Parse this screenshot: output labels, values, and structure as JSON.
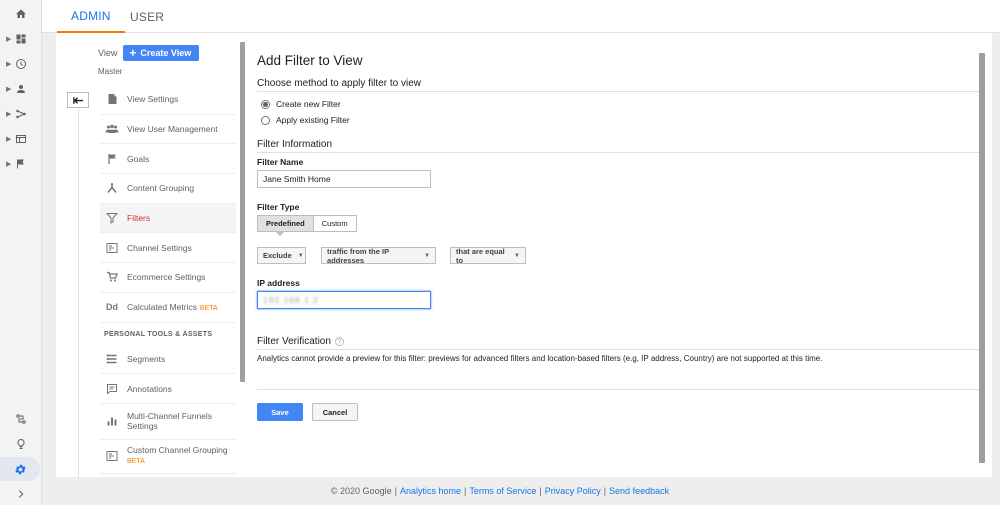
{
  "rail": {
    "icons": [
      "home-icon",
      "dashboard-icon",
      "clock-icon",
      "person-icon",
      "acquisition-icon",
      "behavior-icon",
      "flag-icon"
    ],
    "bottom_icons": [
      "discover-icon",
      "lightbulb-icon",
      "gear-icon",
      "expand-icon"
    ]
  },
  "tabs": [
    {
      "label": "ADMIN"
    },
    {
      "label": "USER"
    }
  ],
  "view": {
    "label": "View",
    "create_button": "Create View",
    "name": "Master"
  },
  "menu": {
    "items": [
      {
        "label": "View Settings",
        "icon": "document-icon"
      },
      {
        "label": "View User Management",
        "icon": "people-icon"
      },
      {
        "label": "Goals",
        "icon": "flag-icon"
      },
      {
        "label": "Content Grouping",
        "icon": "content-grouping-icon"
      },
      {
        "label": "Filters",
        "icon": "filter-icon"
      },
      {
        "label": "Channel Settings",
        "icon": "channel-icon"
      },
      {
        "label": "Ecommerce Settings",
        "icon": "cart-icon"
      },
      {
        "label": "Calculated Metrics",
        "beta": "BETA",
        "icon": "dd-icon"
      }
    ],
    "section_label": "PERSONAL TOOLS & ASSETS",
    "personal_items": [
      {
        "label": "Segments",
        "icon": "segments-icon"
      },
      {
        "label": "Annotations",
        "icon": "annotation-icon"
      },
      {
        "label": "Multi-Channel Funnels Settings",
        "icon": "bar-chart-icon"
      },
      {
        "label": "Custom Channel Grouping",
        "beta": "BETA",
        "icon": "custom-channel-icon"
      }
    ]
  },
  "form": {
    "title": "Add Filter to View",
    "method_title": "Choose method to apply filter to view",
    "radio_new": "Create new Filter",
    "radio_existing": "Apply existing Filter",
    "info_title": "Filter Information",
    "name_label": "Filter Name",
    "name_value": "Jane Smith Home",
    "type_label": "Filter Type",
    "type_predefined": "Predefined",
    "type_custom": "Custom",
    "dd_action": "Exclude",
    "dd_source": "traffic from the IP addresses",
    "dd_condition": "that are equal to",
    "ip_label": "IP address",
    "ip_value": "192.168.1.2",
    "verify_title": "Filter Verification",
    "verify_help": "?",
    "verify_note": "Analytics cannot provide a preview for this filter: previews for advanced filters and location-based filters (e.g, IP address, Country) are not supported at this time.",
    "save": "Save",
    "cancel": "Cancel"
  },
  "footer": {
    "copyright": "© 2020 Google",
    "links": [
      "Analytics home",
      "Terms of Service",
      "Privacy Policy",
      "Send feedback"
    ]
  }
}
